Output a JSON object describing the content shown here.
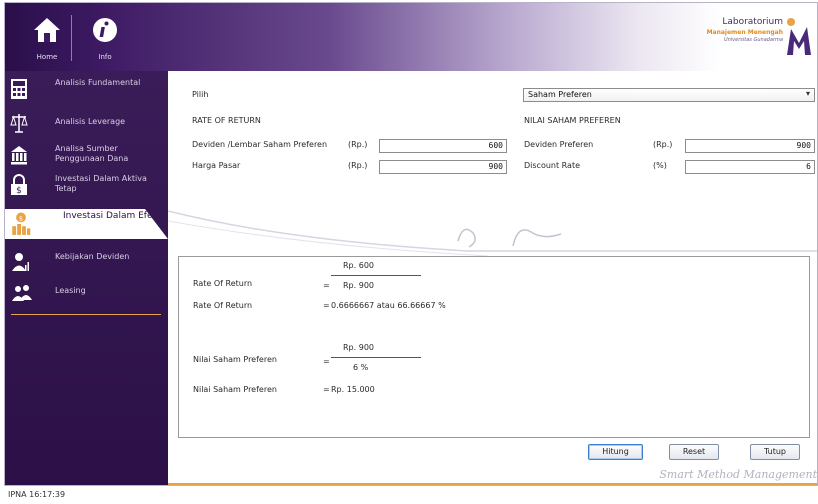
{
  "header": {
    "home_label": "Home",
    "info_label": "Info",
    "brand_title": "Laboratorium",
    "brand_subtitle": "Manajemen Menengah",
    "brand_university": "Universitas Gunadarma",
    "brand_logo_letter": "M"
  },
  "sidebar": {
    "items": [
      {
        "label": "Analisis Fundamental",
        "icon": "calculator-icon"
      },
      {
        "label": "Analisis Leverage",
        "icon": "scale-icon"
      },
      {
        "label": "Analisa Sumber Penggunaan Dana",
        "icon": "bank-icon"
      },
      {
        "label": "Investasi Dalam Aktiva Tetap",
        "icon": "lock-dollar-icon"
      },
      {
        "label": "Investasi Dalam Efek",
        "icon": "coins-chart-icon"
      },
      {
        "label": "Kebijakan Deviden",
        "icon": "person-chart-icon"
      },
      {
        "label": "Leasing",
        "icon": "people-icon"
      }
    ],
    "active_index": 4
  },
  "form": {
    "pilih_label": "Pilih",
    "pilih_value": "Saham Preferen",
    "ror_heading": "RATE OF RETURN",
    "deviden_label": "Deviden /Lembar Saham Preferen",
    "deviden_unit": "(Rp.)",
    "deviden_value": "600",
    "harga_label": "Harga Pasar",
    "harga_unit": "(Rp.)",
    "harga_value": "900",
    "nsp_heading": "NILAI SAHAM PREFEREN",
    "dp_label": "Deviden Preferen",
    "dp_unit": "(Rp.)",
    "dp_value": "900",
    "dr_label": "Discount Rate",
    "dr_unit": "(%)",
    "dr_value": "6"
  },
  "results": {
    "ror_label_1": "Rate Of Return",
    "ror_eq_1": "=",
    "ror_numerator": "Rp. 600",
    "ror_denominator": "Rp. 900",
    "ror_label_2": "Rate Of Return",
    "ror_eq_2": "=",
    "ror_result": "0.6666667 atau 66.66667 %",
    "nsp_label_1": "Nilai Saham Preferen",
    "nsp_eq_1": "=",
    "nsp_numerator": "Rp. 900",
    "nsp_denominator": "6 %",
    "nsp_label_2": "Nilai Saham Preferen",
    "nsp_eq_2": "=",
    "nsp_result": "Rp. 15.000"
  },
  "buttons": {
    "hitung": "Hitung",
    "reset": "Reset",
    "tutup": "Tutup"
  },
  "watermark": "Smart Method Management",
  "status": "IPNA 16:17:39",
  "colors": {
    "sidebar_bg": "#2b0f46",
    "accent_orange": "#e9a346",
    "header_dark": "#2a0f4a"
  }
}
